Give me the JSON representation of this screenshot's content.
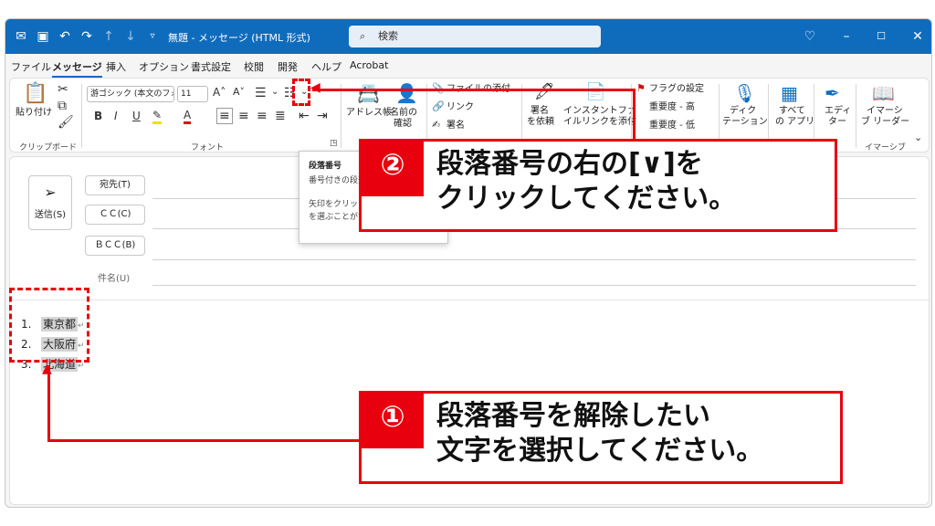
{
  "titlebar": {
    "title": "無題 - メッセージ (HTML 形式)",
    "search_placeholder": "検索",
    "icons": [
      "outlook-icon",
      "save-icon",
      "undo-icon",
      "redo-icon",
      "up-icon",
      "down-icon",
      "customize-icon",
      "lightbulb-icon",
      "minimize-icon",
      "maximize-icon",
      "close-icon"
    ]
  },
  "menu": [
    "ファイル",
    "メッセージ",
    "挿入",
    "オプション",
    "書式設定",
    "校閲",
    "開発",
    "ヘルプ",
    "Acrobat"
  ],
  "ribbon": {
    "clipboard": {
      "paste": "貼り付け",
      "label": "クリップボード"
    },
    "font": {
      "name": "游ゴシック (本文のフォン",
      "size": "11",
      "label": "フォント"
    },
    "names": {
      "address_book": "アドレス帳",
      "check_names_1": "名前の",
      "check_names_2": "確認"
    },
    "include": {
      "attach": "ファイルの添付",
      "link": "リンク",
      "signature": "署名"
    },
    "sign": {
      "line1": "署名",
      "line2": "を依頼"
    },
    "instant": {
      "line1": "インスタントファ",
      "line2": "イルリンクを添付"
    },
    "tags": {
      "flag": "フラグの設定",
      "high": "重要度 - 高",
      "low": "重要度 - 低"
    },
    "dictate": {
      "line1": "ディク",
      "line2": "テーション"
    },
    "apps": {
      "line1": "すべて",
      "line2": "の アプリ"
    },
    "editor": {
      "line1": "エディ",
      "line2": "ター"
    },
    "reader": {
      "line1": "イマーシ",
      "line2": "ブ リーダー",
      "label": "イマーシブ"
    }
  },
  "tooltip": {
    "title": "段落番号",
    "line1": "番号付きの段落",
    "line2": "矢印をクリックす",
    "line3": "を選ぶことができ"
  },
  "compose": {
    "send": "送信(S)",
    "to": "宛先(T)",
    "cc": "ＣＣ(C)",
    "bcc": "ＢＣＣ(B)",
    "subject": "件名(U)"
  },
  "list": [
    {
      "num": "1.",
      "text": "東京都"
    },
    {
      "num": "2.",
      "text": "大阪府"
    },
    {
      "num": "3.",
      "text": "北海道"
    }
  ],
  "return_mark": "↵",
  "callout2": {
    "num": "②",
    "line1": "段落番号の右の[∨]を",
    "line2": "クリックしてください。"
  },
  "callout1": {
    "num": "①",
    "line1": "段落番号を解除したい",
    "line2": "文字を選択してください。"
  },
  "colors": {
    "accent": "#0f6cbd",
    "annotation_red": "#e8000e"
  }
}
